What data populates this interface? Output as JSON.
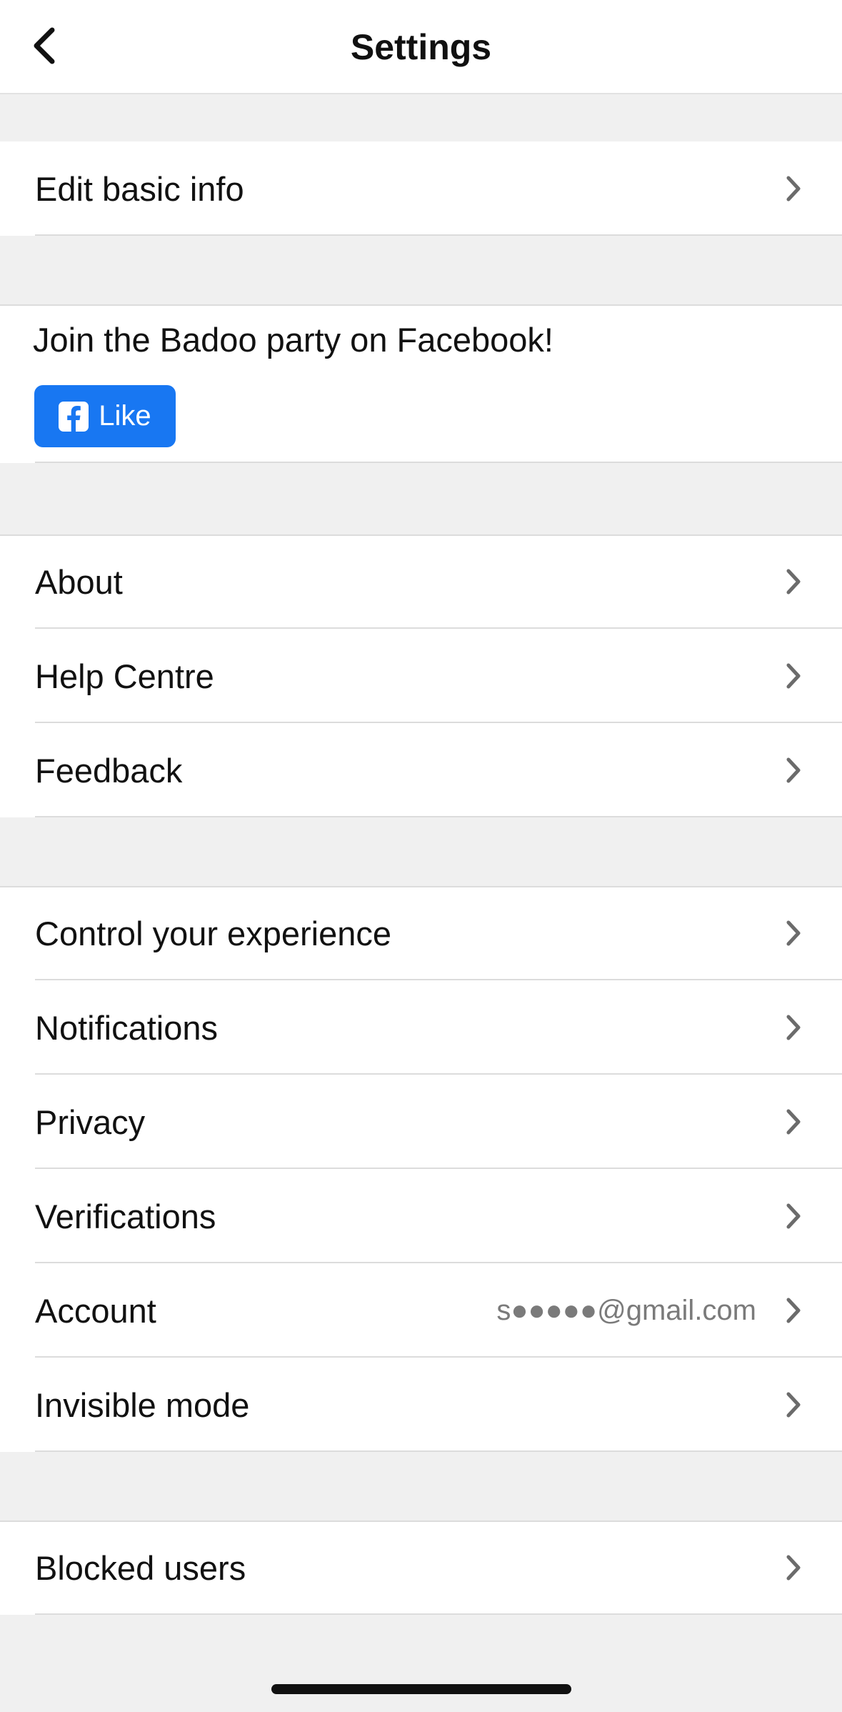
{
  "header": {
    "title": "Settings",
    "back_icon": "chevron-left-icon"
  },
  "sections": {
    "profile": [
      {
        "label": "Edit basic info"
      }
    ],
    "facebook": {
      "text": "Join the Badoo party on Facebook!",
      "button_label": "Like",
      "button_icon": "facebook-icon",
      "button_color": "#1877f2"
    },
    "info": [
      {
        "label": "About"
      },
      {
        "label": "Help Centre"
      },
      {
        "label": "Feedback"
      }
    ],
    "preferences": [
      {
        "label": "Control your experience"
      },
      {
        "label": "Notifications"
      },
      {
        "label": "Privacy"
      },
      {
        "label": "Verifications"
      },
      {
        "label": "Account",
        "value": "s●●●●●@gmail.com"
      },
      {
        "label": "Invisible mode"
      }
    ],
    "blocked": [
      {
        "label": "Blocked users"
      }
    ]
  },
  "row_icon": "chevron-right-icon"
}
